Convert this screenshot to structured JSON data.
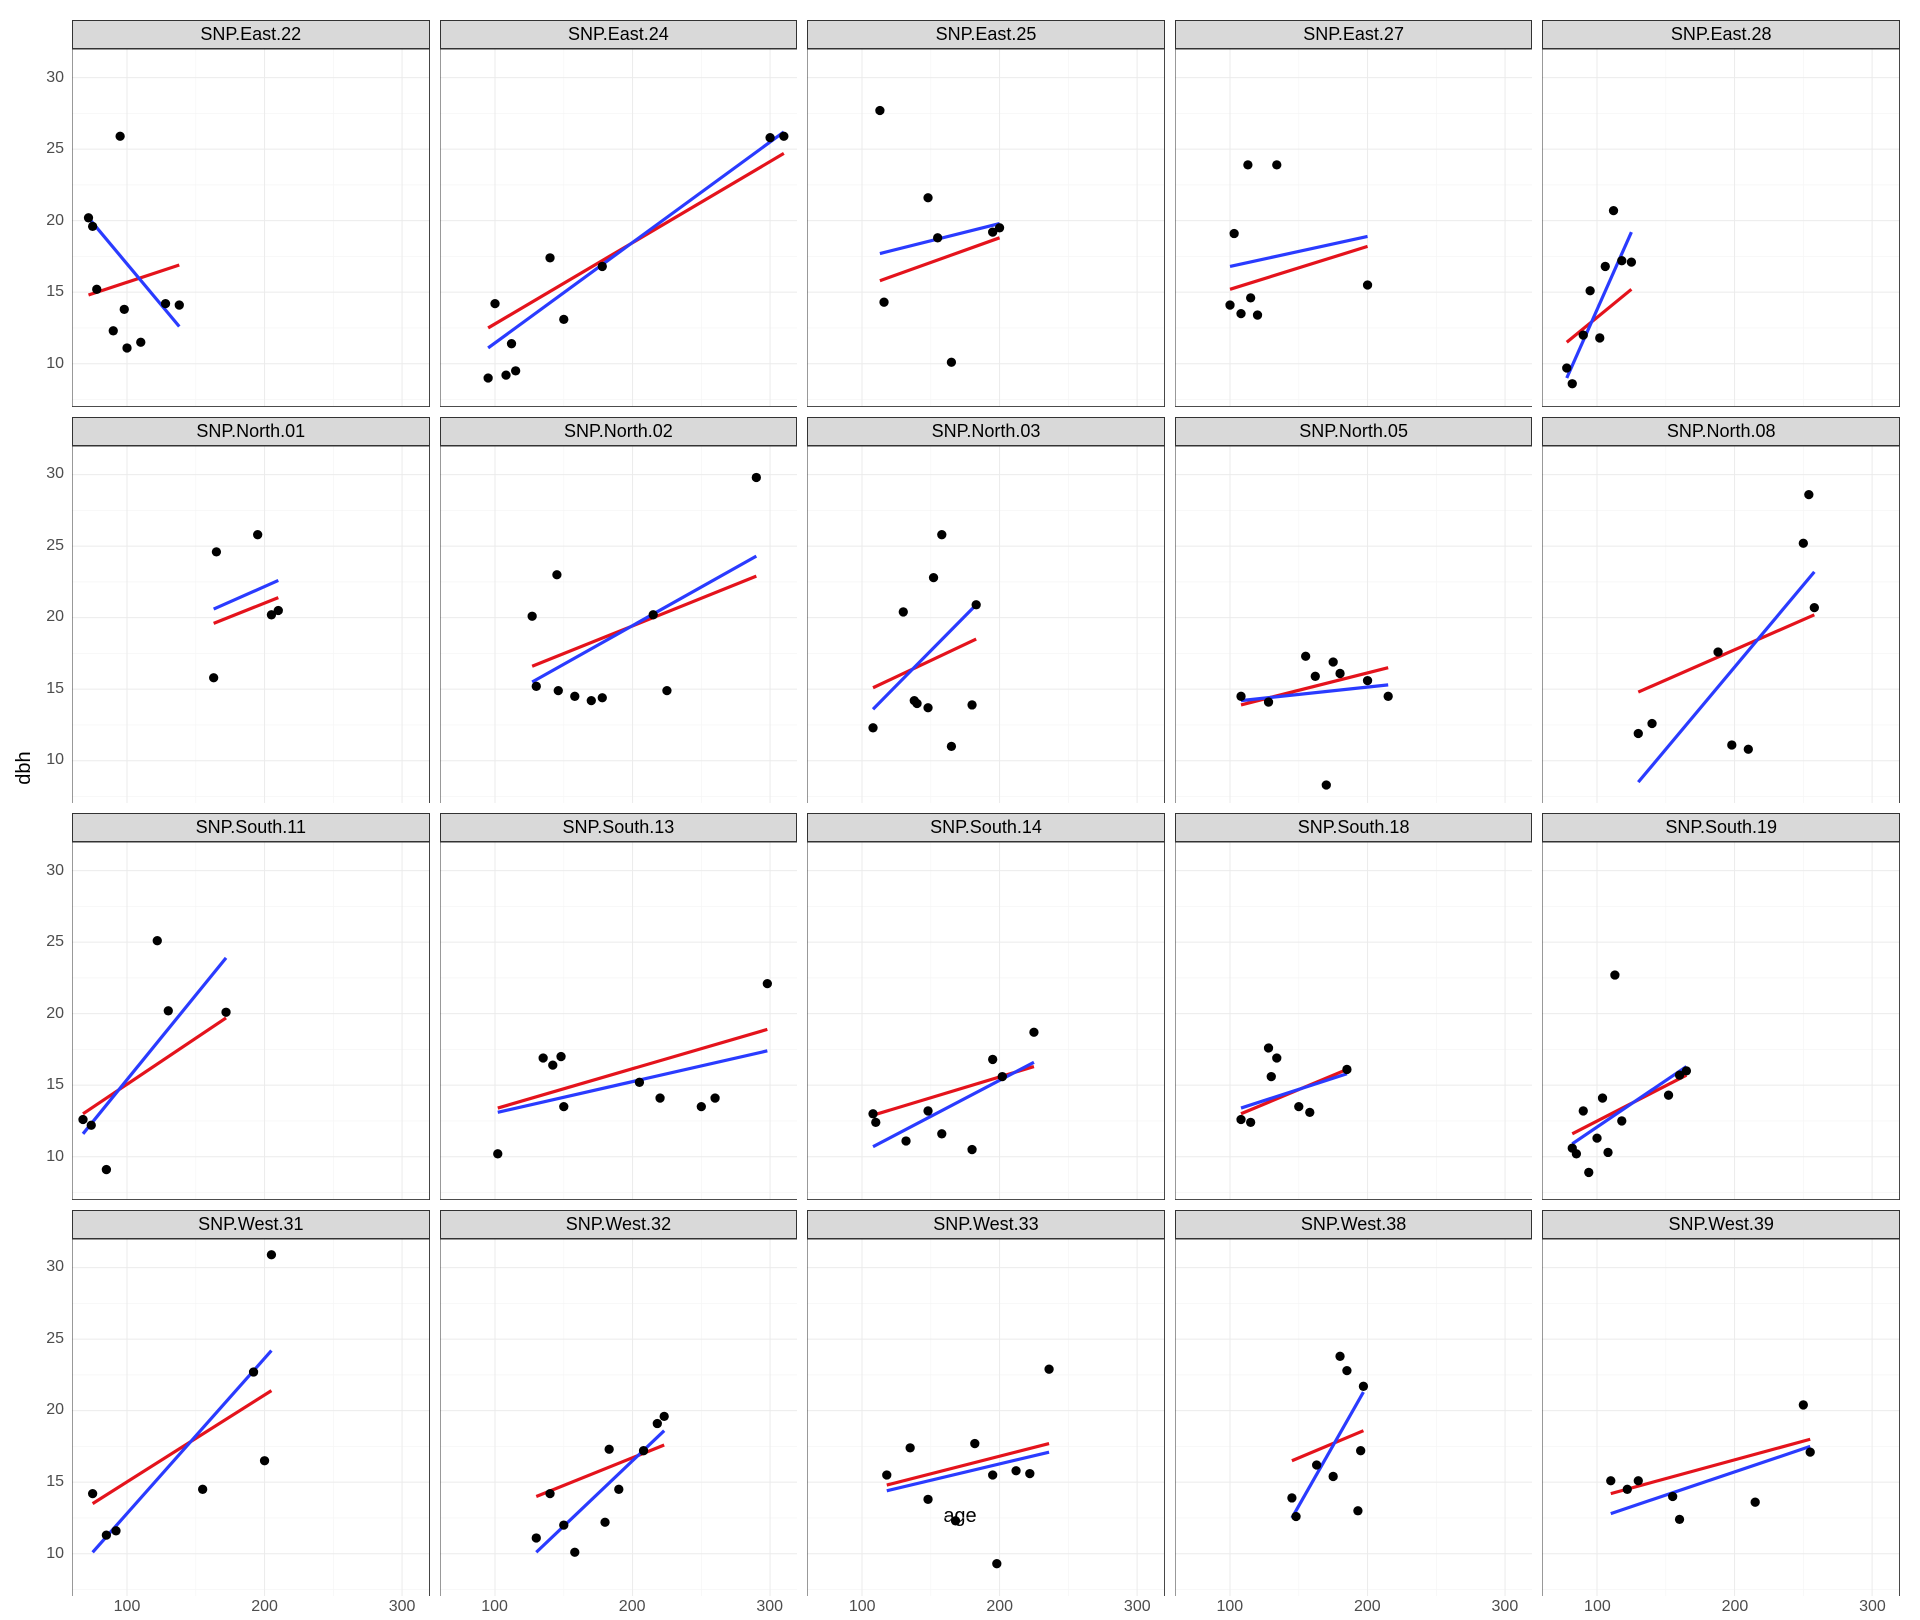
{
  "chart_data": {
    "type": "scatter",
    "xlabel": "age",
    "ylabel": "dbh",
    "xlim": [
      60,
      320
    ],
    "ylim": [
      7,
      32
    ],
    "x_ticks": [
      100,
      200,
      300
    ],
    "y_ticks": [
      10,
      15,
      20,
      25,
      30
    ],
    "ncol": 5,
    "nrow": 4,
    "facets": [
      {
        "label": "SNP.East.22",
        "points": [
          {
            "x": 72,
            "y": 20.2
          },
          {
            "x": 75,
            "y": 19.6
          },
          {
            "x": 78,
            "y": 15.2
          },
          {
            "x": 90,
            "y": 12.3
          },
          {
            "x": 95,
            "y": 25.9
          },
          {
            "x": 98,
            "y": 13.8
          },
          {
            "x": 100,
            "y": 11.1
          },
          {
            "x": 110,
            "y": 11.5
          },
          {
            "x": 128,
            "y": 14.2
          },
          {
            "x": 138,
            "y": 14.1
          }
        ],
        "line_blue": {
          "x1": 72,
          "y1": 20.2,
          "x2": 138,
          "y2": 12.6
        },
        "line_red": {
          "x1": 72,
          "y1": 14.8,
          "x2": 138,
          "y2": 16.9
        }
      },
      {
        "label": "SNP.East.24",
        "points": [
          {
            "x": 95,
            "y": 9.0
          },
          {
            "x": 100,
            "y": 14.2
          },
          {
            "x": 108,
            "y": 9.2
          },
          {
            "x": 112,
            "y": 11.4
          },
          {
            "x": 115,
            "y": 9.5
          },
          {
            "x": 140,
            "y": 17.4
          },
          {
            "x": 150,
            "y": 13.1
          },
          {
            "x": 178,
            "y": 16.8
          },
          {
            "x": 300,
            "y": 25.8
          },
          {
            "x": 310,
            "y": 25.9
          }
        ],
        "line_blue": {
          "x1": 95,
          "y1": 11.1,
          "x2": 310,
          "y2": 26.2
        },
        "line_red": {
          "x1": 95,
          "y1": 12.5,
          "x2": 310,
          "y2": 24.7
        }
      },
      {
        "label": "SNP.East.25",
        "points": [
          {
            "x": 113,
            "y": 27.7
          },
          {
            "x": 116,
            "y": 14.3
          },
          {
            "x": 148,
            "y": 21.6
          },
          {
            "x": 155,
            "y": 18.8
          },
          {
            "x": 165,
            "y": 10.1
          },
          {
            "x": 195,
            "y": 19.2
          },
          {
            "x": 200,
            "y": 19.5
          }
        ],
        "line_blue": {
          "x1": 113,
          "y1": 17.7,
          "x2": 200,
          "y2": 19.8
        },
        "line_red": {
          "x1": 113,
          "y1": 15.8,
          "x2": 200,
          "y2": 18.8
        }
      },
      {
        "label": "SNP.East.27",
        "points": [
          {
            "x": 100,
            "y": 14.1
          },
          {
            "x": 103,
            "y": 19.1
          },
          {
            "x": 108,
            "y": 13.5
          },
          {
            "x": 113,
            "y": 23.9
          },
          {
            "x": 115,
            "y": 14.6
          },
          {
            "x": 120,
            "y": 13.4
          },
          {
            "x": 134,
            "y": 23.9
          },
          {
            "x": 200,
            "y": 15.5
          }
        ],
        "line_blue": {
          "x1": 100,
          "y1": 16.8,
          "x2": 200,
          "y2": 18.9
        },
        "line_red": {
          "x1": 100,
          "y1": 15.2,
          "x2": 200,
          "y2": 18.2
        }
      },
      {
        "label": "SNP.East.28",
        "points": [
          {
            "x": 78,
            "y": 9.7
          },
          {
            "x": 82,
            "y": 8.6
          },
          {
            "x": 90,
            "y": 12.0
          },
          {
            "x": 95,
            "y": 15.1
          },
          {
            "x": 102,
            "y": 11.8
          },
          {
            "x": 106,
            "y": 16.8
          },
          {
            "x": 112,
            "y": 20.7
          },
          {
            "x": 118,
            "y": 17.2
          },
          {
            "x": 125,
            "y": 17.1
          }
        ],
        "line_blue": {
          "x1": 78,
          "y1": 9.0,
          "x2": 125,
          "y2": 19.2
        },
        "line_red": {
          "x1": 78,
          "y1": 11.5,
          "x2": 125,
          "y2": 15.2
        }
      },
      {
        "label": "SNP.North.01",
        "points": [
          {
            "x": 163,
            "y": 15.8
          },
          {
            "x": 165,
            "y": 24.6
          },
          {
            "x": 195,
            "y": 25.8
          },
          {
            "x": 205,
            "y": 20.2
          },
          {
            "x": 210,
            "y": 20.5
          }
        ],
        "line_blue": {
          "x1": 163,
          "y1": 20.6,
          "x2": 210,
          "y2": 22.6
        },
        "line_red": {
          "x1": 163,
          "y1": 19.6,
          "x2": 210,
          "y2": 21.4
        }
      },
      {
        "label": "SNP.North.02",
        "points": [
          {
            "x": 127,
            "y": 20.1
          },
          {
            "x": 130,
            "y": 15.2
          },
          {
            "x": 145,
            "y": 23.0
          },
          {
            "x": 146,
            "y": 14.9
          },
          {
            "x": 158,
            "y": 14.5
          },
          {
            "x": 170,
            "y": 14.2
          },
          {
            "x": 178,
            "y": 14.4
          },
          {
            "x": 215,
            "y": 20.2
          },
          {
            "x": 225,
            "y": 14.9
          },
          {
            "x": 290,
            "y": 29.8
          }
        ],
        "line_blue": {
          "x1": 127,
          "y1": 15.5,
          "x2": 290,
          "y2": 24.3
        },
        "line_red": {
          "x1": 127,
          "y1": 16.6,
          "x2": 290,
          "y2": 22.9
        }
      },
      {
        "label": "SNP.North.03",
        "points": [
          {
            "x": 108,
            "y": 12.3
          },
          {
            "x": 130,
            "y": 20.4
          },
          {
            "x": 138,
            "y": 14.2
          },
          {
            "x": 140,
            "y": 14.0
          },
          {
            "x": 148,
            "y": 13.7
          },
          {
            "x": 152,
            "y": 22.8
          },
          {
            "x": 158,
            "y": 25.8
          },
          {
            "x": 165,
            "y": 11.0
          },
          {
            "x": 180,
            "y": 13.9
          },
          {
            "x": 183,
            "y": 20.9
          }
        ],
        "line_blue": {
          "x1": 108,
          "y1": 13.6,
          "x2": 183,
          "y2": 20.9
        },
        "line_red": {
          "x1": 108,
          "y1": 15.1,
          "x2": 183,
          "y2": 18.5
        }
      },
      {
        "label": "SNP.North.05",
        "points": [
          {
            "x": 108,
            "y": 14.5
          },
          {
            "x": 128,
            "y": 14.1
          },
          {
            "x": 155,
            "y": 17.3
          },
          {
            "x": 162,
            "y": 15.9
          },
          {
            "x": 170,
            "y": 8.3
          },
          {
            "x": 175,
            "y": 16.9
          },
          {
            "x": 180,
            "y": 16.1
          },
          {
            "x": 200,
            "y": 15.6
          },
          {
            "x": 215,
            "y": 14.5
          }
        ],
        "line_blue": {
          "x1": 108,
          "y1": 14.2,
          "x2": 215,
          "y2": 15.3
        },
        "line_red": {
          "x1": 108,
          "y1": 13.9,
          "x2": 215,
          "y2": 16.5
        }
      },
      {
        "label": "SNP.North.08",
        "points": [
          {
            "x": 130,
            "y": 11.9
          },
          {
            "x": 140,
            "y": 12.6
          },
          {
            "x": 188,
            "y": 17.6
          },
          {
            "x": 198,
            "y": 11.1
          },
          {
            "x": 210,
            "y": 10.8
          },
          {
            "x": 250,
            "y": 25.2
          },
          {
            "x": 254,
            "y": 28.6
          },
          {
            "x": 258,
            "y": 20.7
          }
        ],
        "line_blue": {
          "x1": 130,
          "y1": 8.5,
          "x2": 258,
          "y2": 23.2
        },
        "line_red": {
          "x1": 130,
          "y1": 14.8,
          "x2": 258,
          "y2": 20.2
        }
      },
      {
        "label": "SNP.South.11",
        "points": [
          {
            "x": 68,
            "y": 12.6
          },
          {
            "x": 74,
            "y": 12.2
          },
          {
            "x": 85,
            "y": 9.1
          },
          {
            "x": 122,
            "y": 25.1
          },
          {
            "x": 130,
            "y": 20.2
          },
          {
            "x": 172,
            "y": 20.1
          }
        ],
        "line_blue": {
          "x1": 68,
          "y1": 11.6,
          "x2": 172,
          "y2": 23.9
        },
        "line_red": {
          "x1": 68,
          "y1": 13.0,
          "x2": 172,
          "y2": 19.7
        }
      },
      {
        "label": "SNP.South.13",
        "points": [
          {
            "x": 102,
            "y": 10.2
          },
          {
            "x": 135,
            "y": 16.9
          },
          {
            "x": 142,
            "y": 16.4
          },
          {
            "x": 148,
            "y": 17.0
          },
          {
            "x": 150,
            "y": 13.5
          },
          {
            "x": 205,
            "y": 15.2
          },
          {
            "x": 220,
            "y": 14.1
          },
          {
            "x": 250,
            "y": 13.5
          },
          {
            "x": 260,
            "y": 14.1
          },
          {
            "x": 298,
            "y": 22.1
          }
        ],
        "line_blue": {
          "x1": 102,
          "y1": 13.1,
          "x2": 298,
          "y2": 17.4
        },
        "line_red": {
          "x1": 102,
          "y1": 13.4,
          "x2": 298,
          "y2": 18.9
        }
      },
      {
        "label": "SNP.South.14",
        "points": [
          {
            "x": 108,
            "y": 13.0
          },
          {
            "x": 110,
            "y": 12.4
          },
          {
            "x": 132,
            "y": 11.1
          },
          {
            "x": 148,
            "y": 13.2
          },
          {
            "x": 158,
            "y": 11.6
          },
          {
            "x": 180,
            "y": 10.5
          },
          {
            "x": 195,
            "y": 16.8
          },
          {
            "x": 202,
            "y": 15.6
          },
          {
            "x": 225,
            "y": 18.7
          }
        ],
        "line_blue": {
          "x1": 108,
          "y1": 10.7,
          "x2": 225,
          "y2": 16.6
        },
        "line_red": {
          "x1": 108,
          "y1": 12.9,
          "x2": 225,
          "y2": 16.3
        }
      },
      {
        "label": "SNP.South.18",
        "points": [
          {
            "x": 108,
            "y": 12.6
          },
          {
            "x": 115,
            "y": 12.4
          },
          {
            "x": 128,
            "y": 17.6
          },
          {
            "x": 130,
            "y": 15.6
          },
          {
            "x": 134,
            "y": 16.9
          },
          {
            "x": 150,
            "y": 13.5
          },
          {
            "x": 158,
            "y": 13.1
          },
          {
            "x": 185,
            "y": 16.1
          }
        ],
        "line_blue": {
          "x1": 108,
          "y1": 13.4,
          "x2": 185,
          "y2": 15.8
        },
        "line_red": {
          "x1": 108,
          "y1": 13.0,
          "x2": 185,
          "y2": 16.1
        }
      },
      {
        "label": "SNP.South.19",
        "points": [
          {
            "x": 82,
            "y": 10.6
          },
          {
            "x": 85,
            "y": 10.2
          },
          {
            "x": 90,
            "y": 13.2
          },
          {
            "x": 94,
            "y": 8.9
          },
          {
            "x": 100,
            "y": 11.3
          },
          {
            "x": 104,
            "y": 14.1
          },
          {
            "x": 108,
            "y": 10.3
          },
          {
            "x": 113,
            "y": 22.7
          },
          {
            "x": 118,
            "y": 12.5
          },
          {
            "x": 152,
            "y": 14.3
          },
          {
            "x": 160,
            "y": 15.7
          },
          {
            "x": 165,
            "y": 16.0
          }
        ],
        "line_blue": {
          "x1": 82,
          "y1": 10.9,
          "x2": 165,
          "y2": 16.3
        },
        "line_red": {
          "x1": 82,
          "y1": 11.6,
          "x2": 165,
          "y2": 15.7
        }
      },
      {
        "label": "SNP.West.31",
        "points": [
          {
            "x": 75,
            "y": 14.2
          },
          {
            "x": 85,
            "y": 11.3
          },
          {
            "x": 92,
            "y": 11.6
          },
          {
            "x": 155,
            "y": 14.5
          },
          {
            "x": 192,
            "y": 22.7
          },
          {
            "x": 200,
            "y": 16.5
          },
          {
            "x": 205,
            "y": 30.9
          }
        ],
        "line_blue": {
          "x1": 75,
          "y1": 10.1,
          "x2": 205,
          "y2": 24.2
        },
        "line_red": {
          "x1": 75,
          "y1": 13.5,
          "x2": 205,
          "y2": 21.4
        }
      },
      {
        "label": "SNP.West.32",
        "points": [
          {
            "x": 130,
            "y": 11.1
          },
          {
            "x": 140,
            "y": 14.2
          },
          {
            "x": 150,
            "y": 12.0
          },
          {
            "x": 158,
            "y": 10.1
          },
          {
            "x": 180,
            "y": 12.2
          },
          {
            "x": 183,
            "y": 17.3
          },
          {
            "x": 190,
            "y": 14.5
          },
          {
            "x": 208,
            "y": 17.2
          },
          {
            "x": 218,
            "y": 19.1
          },
          {
            "x": 223,
            "y": 19.6
          }
        ],
        "line_blue": {
          "x1": 130,
          "y1": 10.1,
          "x2": 223,
          "y2": 18.6
        },
        "line_red": {
          "x1": 130,
          "y1": 14.0,
          "x2": 223,
          "y2": 17.6
        }
      },
      {
        "label": "SNP.West.33",
        "points": [
          {
            "x": 118,
            "y": 15.5
          },
          {
            "x": 135,
            "y": 17.4
          },
          {
            "x": 148,
            "y": 13.8
          },
          {
            "x": 168,
            "y": 12.3
          },
          {
            "x": 182,
            "y": 17.7
          },
          {
            "x": 195,
            "y": 15.5
          },
          {
            "x": 198,
            "y": 9.3
          },
          {
            "x": 212,
            "y": 15.8
          },
          {
            "x": 222,
            "y": 15.6
          },
          {
            "x": 236,
            "y": 22.9
          }
        ],
        "line_blue": {
          "x1": 118,
          "y1": 14.4,
          "x2": 236,
          "y2": 17.1
        },
        "line_red": {
          "x1": 118,
          "y1": 14.8,
          "x2": 236,
          "y2": 17.7
        }
      },
      {
        "label": "SNP.West.38",
        "points": [
          {
            "x": 145,
            "y": 13.9
          },
          {
            "x": 148,
            "y": 12.6
          },
          {
            "x": 163,
            "y": 16.2
          },
          {
            "x": 175,
            "y": 15.4
          },
          {
            "x": 180,
            "y": 23.8
          },
          {
            "x": 185,
            "y": 22.8
          },
          {
            "x": 193,
            "y": 13.0
          },
          {
            "x": 195,
            "y": 17.2
          },
          {
            "x": 197,
            "y": 21.7
          }
        ],
        "line_blue": {
          "x1": 145,
          "y1": 12.5,
          "x2": 197,
          "y2": 21.3
        },
        "line_red": {
          "x1": 145,
          "y1": 16.5,
          "x2": 197,
          "y2": 18.6
        }
      },
      {
        "label": "SNP.West.39",
        "points": [
          {
            "x": 110,
            "y": 15.1
          },
          {
            "x": 122,
            "y": 14.5
          },
          {
            "x": 130,
            "y": 15.1
          },
          {
            "x": 155,
            "y": 14.0
          },
          {
            "x": 160,
            "y": 12.4
          },
          {
            "x": 215,
            "y": 13.6
          },
          {
            "x": 250,
            "y": 20.4
          },
          {
            "x": 255,
            "y": 17.1
          }
        ],
        "line_blue": {
          "x1": 110,
          "y1": 12.8,
          "x2": 255,
          "y2": 17.5
        },
        "line_red": {
          "x1": 110,
          "y1": 14.2,
          "x2": 255,
          "y2": 18.0
        }
      }
    ]
  }
}
